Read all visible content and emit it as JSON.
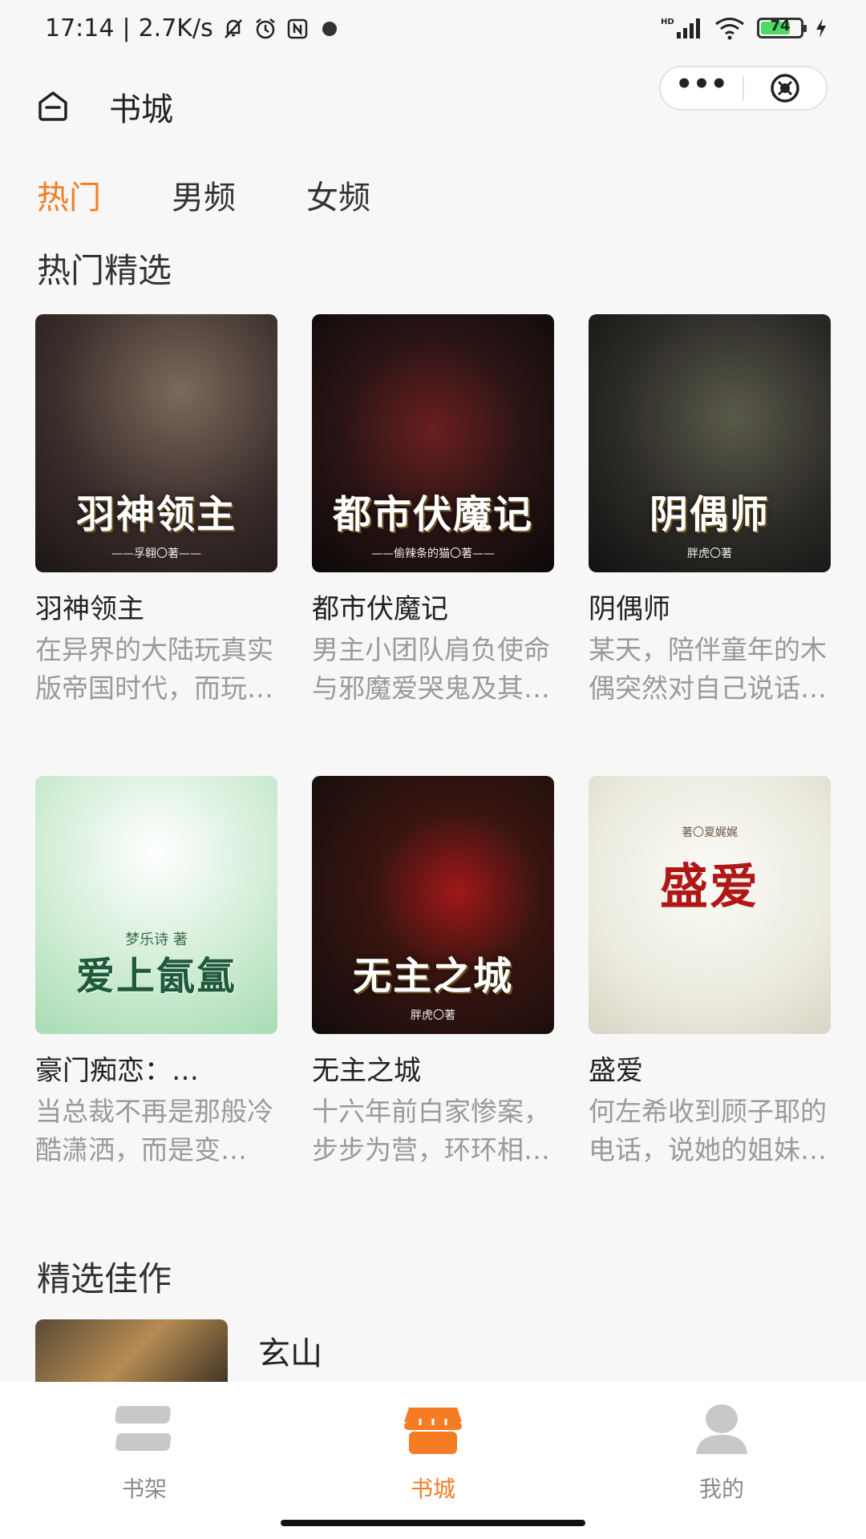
{
  "status_bar": {
    "time": "17:14",
    "speed": "2.7K/s",
    "network": "HD",
    "battery": "74"
  },
  "header": {
    "title": "书城",
    "more_label": "•••"
  },
  "tabs": [
    {
      "label": "热门",
      "active": true
    },
    {
      "label": "男频",
      "active": false
    },
    {
      "label": "女频",
      "active": false
    }
  ],
  "sections": {
    "hot_title": "热门精选",
    "featured_title": "精选佳作"
  },
  "hot_books": [
    {
      "name": "羽神领主",
      "desc": "在异界的大陆玩真实版帝国时代，而玩…",
      "cover_title": "羽神领主",
      "cover_author": "——孚翱〇著——"
    },
    {
      "name": "都市伏魔记",
      "desc": "男主小团队肩负使命与邪魔爱哭鬼及其…",
      "cover_title": "都市伏魔记",
      "cover_author": "——偷辣条的猫〇著——"
    },
    {
      "name": "阴偶师",
      "desc": "某天，陪伴童年的木偶突然对自己说话…",
      "cover_title": "阴偶师",
      "cover_author": "胖虎〇著"
    },
    {
      "name": "豪门痴恋：…",
      "desc": "当总裁不再是那般冷酷潇洒，而是变…",
      "cover_title": "爱上氤氲",
      "cover_author": "梦乐诗 著"
    },
    {
      "name": "无主之城",
      "desc": "十六年前白家惨案，步步为营，环环相…",
      "cover_title": "无主之城",
      "cover_author": "胖虎〇著"
    },
    {
      "name": "盛爱",
      "desc": "何左希收到顾子耶的电话，说她的姐妹…",
      "cover_title": "盛爱",
      "cover_author": "著〇夏娓娓"
    }
  ],
  "featured_books": [
    {
      "name": "玄山"
    }
  ],
  "bottom_nav": [
    {
      "label": "书架",
      "icon": "bookshelf-icon",
      "active": false
    },
    {
      "label": "书城",
      "icon": "store-icon",
      "active": true
    },
    {
      "label": "我的",
      "icon": "profile-icon",
      "active": false
    }
  ],
  "colors": {
    "accent": "#f57c23",
    "desc_gray": "#9a9a9a",
    "background": "#f7f7f7"
  }
}
